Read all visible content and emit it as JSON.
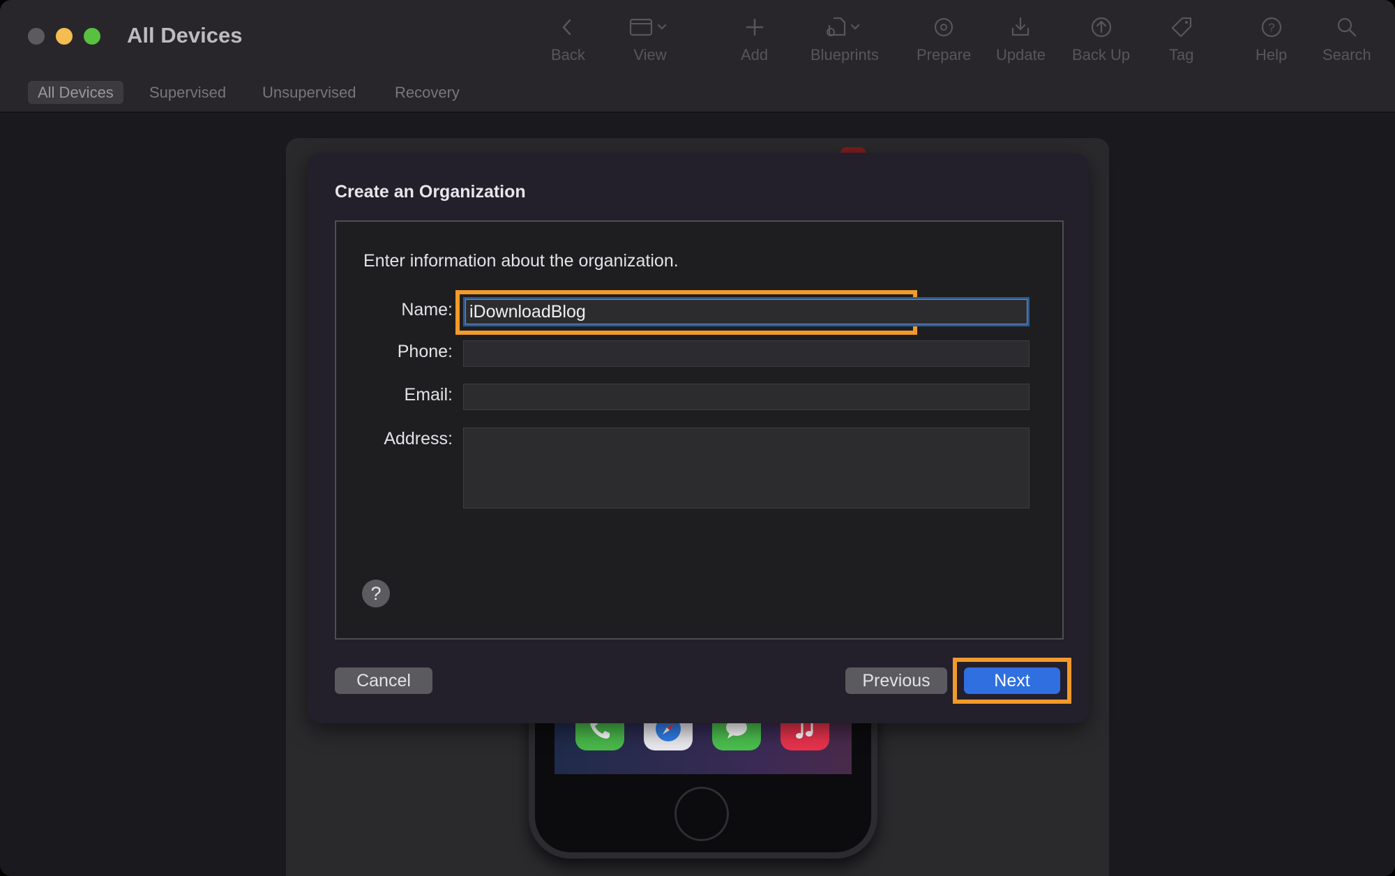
{
  "window": {
    "title": "All Devices",
    "traffic_lights": [
      "#5b5a5e",
      "#f5bd4f",
      "#58c140"
    ]
  },
  "toolbar": {
    "items": [
      {
        "label": "Back",
        "icon": "chevron-left-icon"
      },
      {
        "label": "View",
        "icon": "window-view-icon"
      },
      {
        "label": "Add",
        "icon": "plus-icon"
      },
      {
        "label": "Blueprints",
        "icon": "blueprints-icon"
      },
      {
        "label": "Prepare",
        "icon": "gear-icon"
      },
      {
        "label": "Update",
        "icon": "download-tray-icon"
      },
      {
        "label": "Back Up",
        "icon": "arrow-up-circle-icon"
      },
      {
        "label": "Tag",
        "icon": "tag-icon"
      },
      {
        "label": "Help",
        "icon": "question-circle-icon"
      },
      {
        "label": "Search",
        "icon": "magnifier-icon"
      }
    ]
  },
  "scopes": {
    "items": [
      {
        "label": "All Devices",
        "active": true
      },
      {
        "label": "Supervised",
        "active": false
      },
      {
        "label": "Unsupervised",
        "active": false
      },
      {
        "label": "Recovery",
        "active": false
      }
    ]
  },
  "dialog": {
    "title": "Create an Organization",
    "intro": "Enter information about the organization.",
    "fields": {
      "name_label": "Name:",
      "name_value": "iDownloadBlog",
      "phone_label": "Phone:",
      "phone_value": "",
      "email_label": "Email:",
      "email_value": "",
      "address_label": "Address:",
      "address_value": ""
    },
    "help_glyph": "?",
    "buttons": {
      "cancel": "Cancel",
      "previous": "Previous",
      "next": "Next"
    }
  },
  "colors": {
    "accent": "#2f6fe0",
    "highlight_annotation": "#f29a2b"
  }
}
